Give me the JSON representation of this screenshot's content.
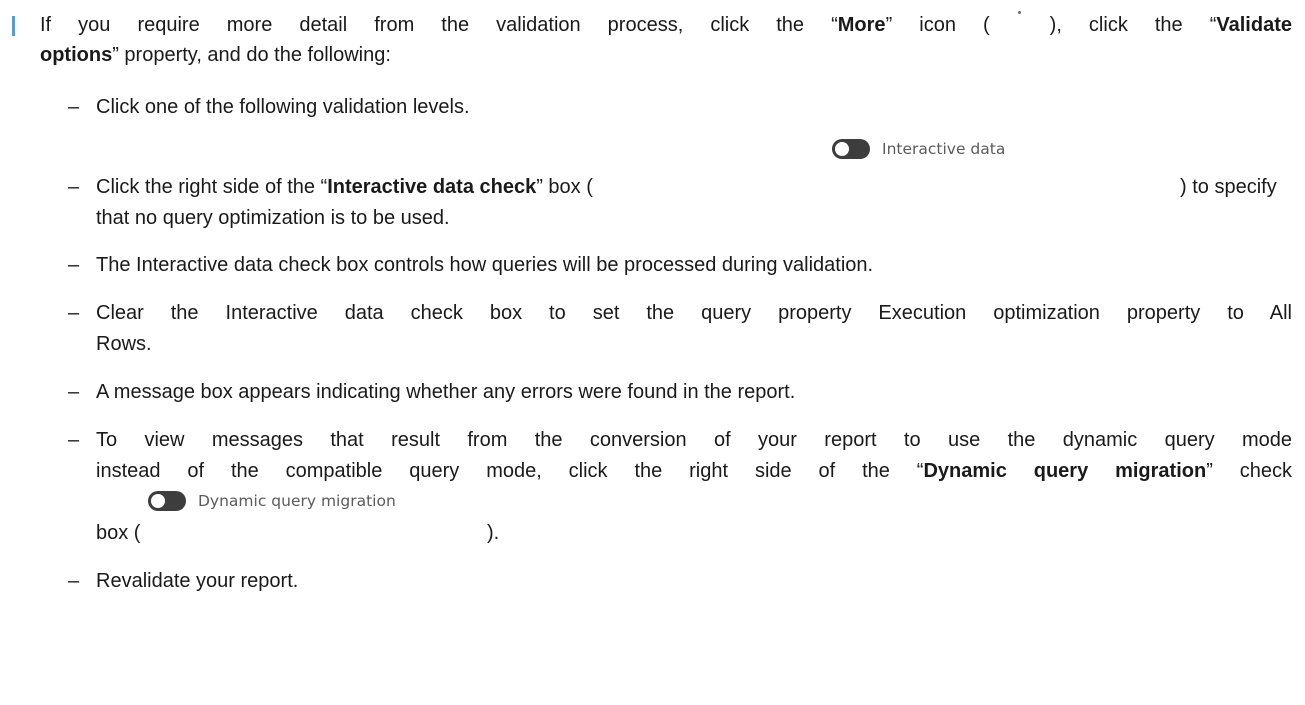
{
  "intro": {
    "text_before_more": "If you require more detail from the validation process, click the “",
    "more_label": "More",
    "text_after_more": "” icon (",
    "text_after_icon": "), click the “",
    "validate_label": "Validate",
    "options_label": "options",
    "text_after_options": "” property, and do the following:"
  },
  "steps": {
    "dash": "–",
    "step1": "Click one of the following validation levels.",
    "step2_before": "Click the right side of the “",
    "step2_bold": "Interactive data check",
    "step2_box_open": "” box (",
    "step2_after": ") to specify",
    "step2_line2": "that no query optimization is to be used.",
    "step3": "The Interactive data check box controls how queries will be processed during validation.",
    "step4_line1": "Clear the Interactive data check box to set the query property Execution optimization property to All",
    "step4_line2": "Rows.",
    "step5": "A message box appears indicating whether any errors were found in the report.",
    "step6_line1": "To view messages that result from the conversion of your report to use the dynamic query mode",
    "step6_line2_before": "instead of the compatible query mode, click the right side of the “",
    "step6_line2_bold": "Dynamic query migration",
    "step6_line2_after": "” check",
    "step6_line3_open": "box (",
    "step6_line3_close": ").",
    "step7": "Revalidate your report."
  },
  "icons": {
    "more_icon": "more-vertical-dots",
    "toggle_icon": "toggle-switch-off"
  },
  "toggles": {
    "interactive_data_label": "Interactive data",
    "dynamic_query_label": "Dynamic query migration"
  },
  "colors": {
    "bullet": "#5a9bd5",
    "text": "#1a1a1a",
    "toggle_track": "#3d3d3d",
    "toggle_label": "#5b5b5b"
  }
}
